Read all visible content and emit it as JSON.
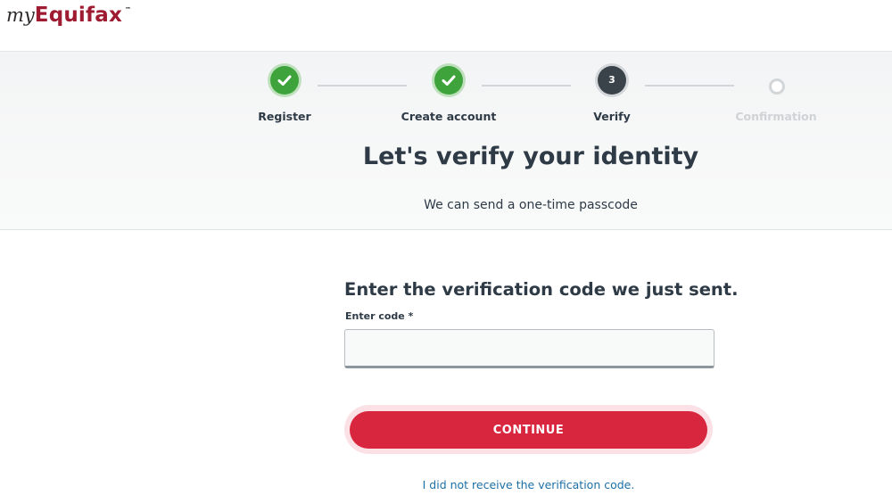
{
  "header": {
    "logo": {
      "prefix": "my",
      "brand": "Equifax",
      "trademark": "™"
    }
  },
  "stepper": {
    "steps": [
      {
        "label": "Register",
        "state": "done",
        "icon": "check-icon"
      },
      {
        "label": "Create account",
        "state": "done",
        "icon": "check-icon"
      },
      {
        "label": "Verify",
        "state": "current",
        "number": "3"
      },
      {
        "label": "Confirmation",
        "state": "todo"
      }
    ]
  },
  "hero": {
    "title": "Let's verify your identity",
    "subtitle": "We can send a one-time passcode"
  },
  "form": {
    "heading": "Enter the verification code we just sent.",
    "code_label": "Enter code *",
    "code_value": "",
    "continue_label": "CONTINUE",
    "resend_link": "I did not receive the verification code."
  },
  "colors": {
    "brand": "#9e1b32",
    "primary_button": "#d7263d",
    "step_done": "#3fa33b",
    "step_current": "#3a424a",
    "link": "#1d6fa5"
  }
}
